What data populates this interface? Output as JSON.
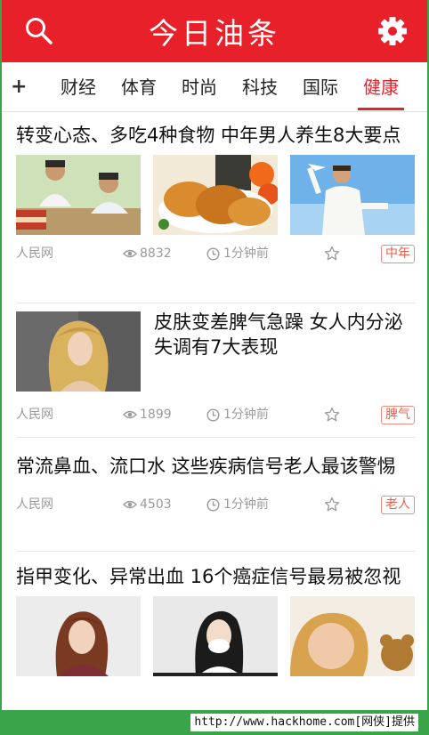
{
  "header": {
    "title": "今日油条"
  },
  "tabs": {
    "add_label": "+",
    "items": [
      {
        "label": "财经"
      },
      {
        "label": "体育"
      },
      {
        "label": "时尚"
      },
      {
        "label": "科技"
      },
      {
        "label": "国际"
      },
      {
        "label": "健康"
      }
    ],
    "active_index": 5
  },
  "news": [
    {
      "title": "转变心态、多吃4种食物 中年男人养生8大要点",
      "source": "人民网",
      "views": "8832",
      "time": "1分钟前",
      "tag": "中年"
    },
    {
      "title": "皮肤变差脾气急躁 女人内分泌失调有7大表现",
      "source": "人民网",
      "views": "1899",
      "time": "1分钟前",
      "tag": "脾气"
    },
    {
      "title": "常流鼻血、流口水 这些疾病信号老人最该警惕",
      "source": "人民网",
      "views": "4503",
      "time": "1分钟前",
      "tag": "老人"
    },
    {
      "title": "指甲变化、异常出血 16个癌症信号最易被忽视"
    }
  ],
  "footer": {
    "watermark": "http://www.hackhome.com[网侠]提供"
  },
  "colors": {
    "brand": "#e8202a",
    "frame": "#3aa44a",
    "tag": "#e8604f"
  }
}
